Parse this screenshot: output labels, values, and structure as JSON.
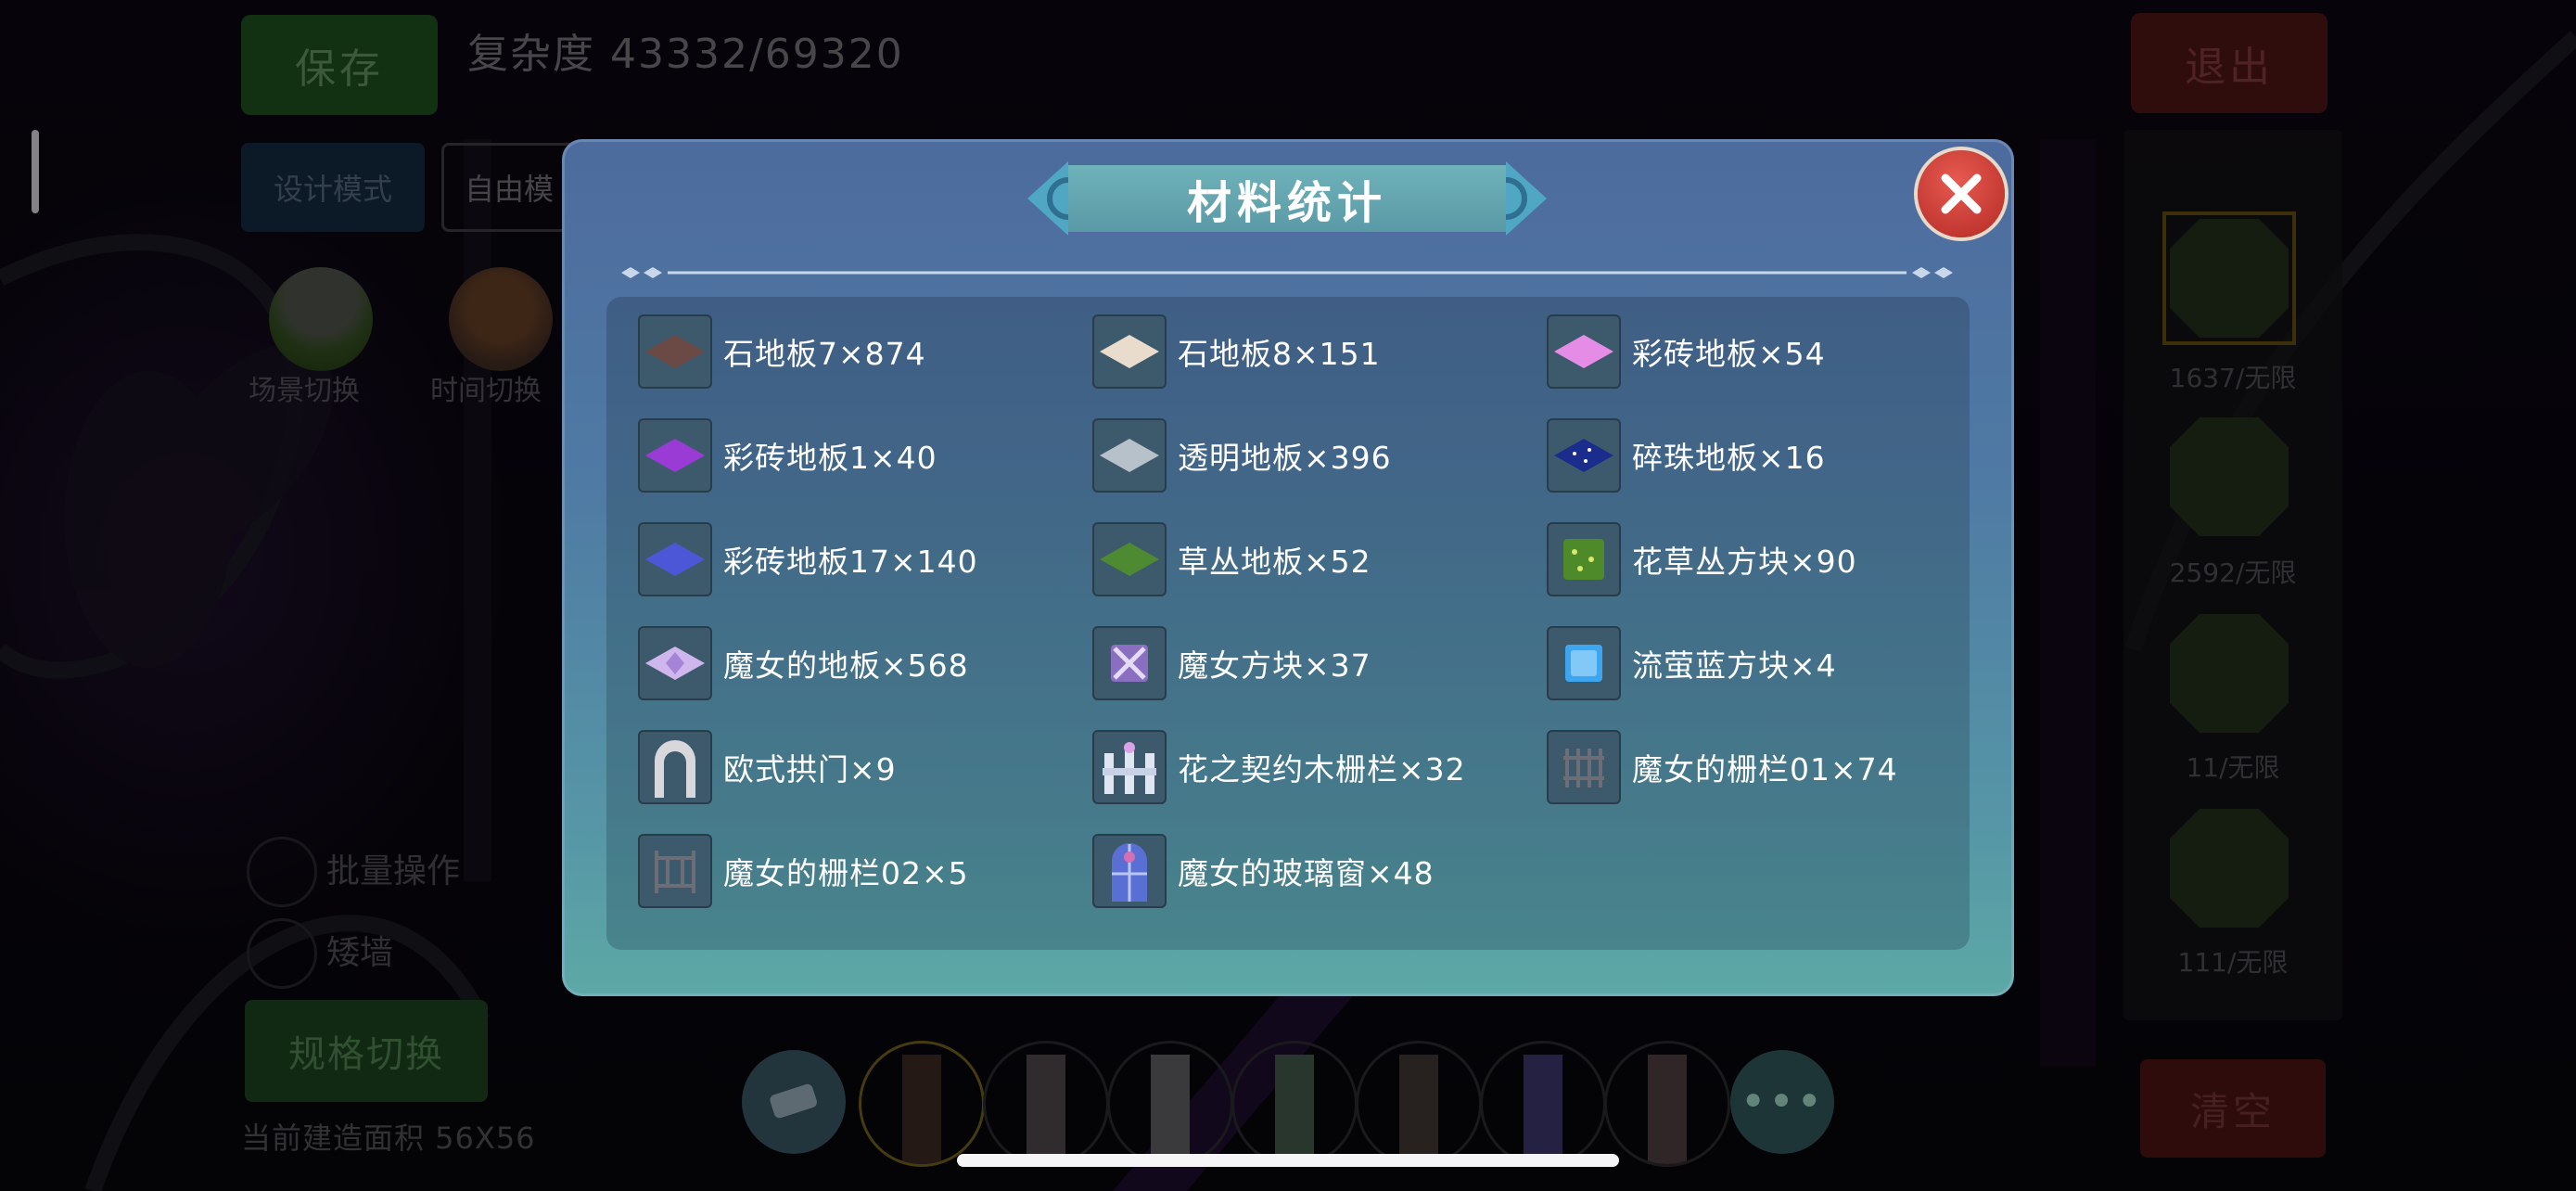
{
  "top_left": {
    "save_label": "保存",
    "complexity_label": "复杂度 43332/69320"
  },
  "mode_buttons": {
    "design_mode": "设计模式",
    "free_mode": "自由模"
  },
  "round_buttons": {
    "scene_switch": "场景切换",
    "time_switch": "时间切换"
  },
  "options": {
    "batch_operation": "批量操作",
    "low_wall": "矮墙"
  },
  "spec_switch_label": "规格切换",
  "build_area_label": "当前建造面积 56X56",
  "exit_label": "退出",
  "clear_label": "清空",
  "material_slots": [
    "1637/无限",
    "2592/无限",
    "11/无限",
    "111/无限"
  ],
  "modal": {
    "title": "材料统计",
    "items": [
      {
        "name": "石地板7×874",
        "icon": "stone-floor-7-tile",
        "color": "#6b4a46"
      },
      {
        "name": "石地板8×151",
        "icon": "stone-floor-8-tile",
        "color": "#e9dccd"
      },
      {
        "name": "彩砖地板×54",
        "icon": "pink-tile",
        "color": "#e58de6"
      },
      {
        "name": "彩砖地板1×40",
        "icon": "purple-tile",
        "color": "#9b3bd6"
      },
      {
        "name": "透明地板×396",
        "icon": "transparent-tile",
        "color": "#b7c1c9"
      },
      {
        "name": "碎珠地板×16",
        "icon": "starry-tile",
        "color": "#1b2d8c"
      },
      {
        "name": "彩砖地板17×140",
        "icon": "blue-tile",
        "color": "#4c57d8"
      },
      {
        "name": "草丛地板×52",
        "icon": "grass-tile",
        "color": "#4d8a32"
      },
      {
        "name": "花草丛方块×90",
        "icon": "flower-bush-block",
        "color": "#4f8a2a"
      },
      {
        "name": "魔女的地板×568",
        "icon": "witch-floor",
        "color": "#cfb6ec"
      },
      {
        "name": "魔女方块×37",
        "icon": "witch-block",
        "color": "#8a6fc0"
      },
      {
        "name": "流萤蓝方块×4",
        "icon": "firefly-blue-block",
        "color": "#3ea6f0"
      },
      {
        "name": "欧式拱门×9",
        "icon": "arch-door",
        "color": "#d8d8dc"
      },
      {
        "name": "花之契约木栅栏×32",
        "icon": "flower-fence",
        "color": "#dfe6f2"
      },
      {
        "name": "魔女的栅栏01×74",
        "icon": "witch-fence-01",
        "color": "#4b4b55"
      },
      {
        "name": "魔女的栅栏02×5",
        "icon": "witch-fence-02",
        "color": "#4b4b55"
      },
      {
        "name": "魔女的玻璃窗×48",
        "icon": "witch-glass-window",
        "color": "#5a6fd4"
      }
    ]
  }
}
